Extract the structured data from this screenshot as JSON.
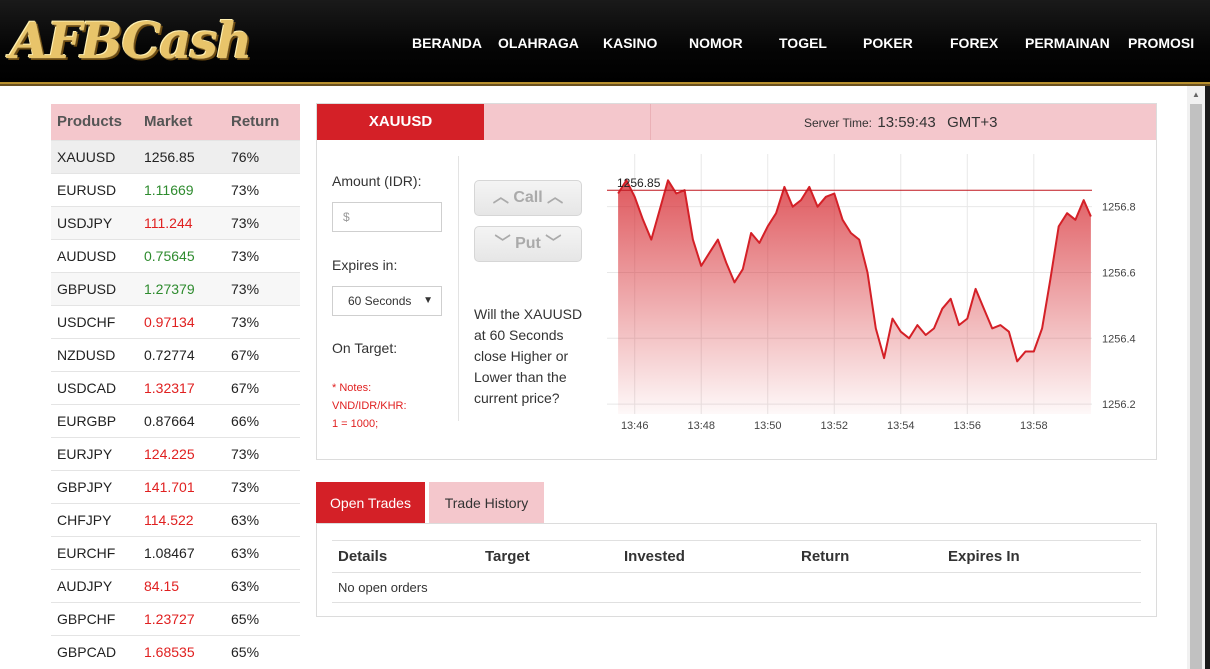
{
  "header": {
    "logo_text": "AFBCash",
    "nav": [
      "BERANDA",
      "OLAHRAGA",
      "KASINO",
      "NOMOR",
      "TOGEL",
      "POKER",
      "FOREX",
      "PERMAINAN",
      "PROMOSI"
    ]
  },
  "products": {
    "headers": [
      "Products",
      "Market",
      "Return"
    ],
    "rows": [
      {
        "product": "XAUUSD",
        "market": "1256.85",
        "return": "76%",
        "trend": "neutral"
      },
      {
        "product": "EURUSD",
        "market": "1.11669",
        "return": "73%",
        "trend": "up"
      },
      {
        "product": "USDJPY",
        "market": "111.244",
        "return": "73%",
        "trend": "down"
      },
      {
        "product": "AUDUSD",
        "market": "0.75645",
        "return": "73%",
        "trend": "up"
      },
      {
        "product": "GBPUSD",
        "market": "1.27379",
        "return": "73%",
        "trend": "up"
      },
      {
        "product": "USDCHF",
        "market": "0.97134",
        "return": "73%",
        "trend": "down"
      },
      {
        "product": "NZDUSD",
        "market": "0.72774",
        "return": "67%",
        "trend": "neutral"
      },
      {
        "product": "USDCAD",
        "market": "1.32317",
        "return": "67%",
        "trend": "down"
      },
      {
        "product": "EURGBP",
        "market": "0.87664",
        "return": "66%",
        "trend": "neutral"
      },
      {
        "product": "EURJPY",
        "market": "124.225",
        "return": "73%",
        "trend": "down"
      },
      {
        "product": "GBPJPY",
        "market": "141.701",
        "return": "73%",
        "trend": "down"
      },
      {
        "product": "CHFJPY",
        "market": "114.522",
        "return": "63%",
        "trend": "down"
      },
      {
        "product": "EURCHF",
        "market": "1.08467",
        "return": "63%",
        "trend": "neutral"
      },
      {
        "product": "AUDJPY",
        "market": "84.15",
        "return": "63%",
        "trend": "down"
      },
      {
        "product": "GBPCHF",
        "market": "1.23727",
        "return": "65%",
        "trend": "down"
      },
      {
        "product": "GBPCAD",
        "market": "1.68535",
        "return": "65%",
        "trend": "down"
      }
    ]
  },
  "trade": {
    "symbol": "XAUUSD",
    "server_time_label": "Server Time:",
    "server_time": "13:59:43",
    "timezone": "GMT+3",
    "amount_label": "Amount (IDR):",
    "amount_placeholder": "$",
    "expires_label": "Expires in:",
    "expires_value": "60 Seconds",
    "on_target_label": "On Target:",
    "notes": [
      "* Notes:",
      "VND/IDR/KHR:",
      "1 = 1000;"
    ],
    "call_label": "Call",
    "put_label": "Put",
    "question": "Will the XAUUSD at 60 Seconds close Higher or Lower than the current price?"
  },
  "chart_data": {
    "type": "area",
    "x": [
      "13:45:30",
      "13:45:45",
      "13:46:00",
      "13:46:15",
      "13:46:30",
      "13:46:45",
      "13:47:00",
      "13:47:15",
      "13:47:30",
      "13:47:45",
      "13:48:00",
      "13:48:15",
      "13:48:30",
      "13:48:45",
      "13:49:00",
      "13:49:15",
      "13:49:30",
      "13:49:45",
      "13:50:00",
      "13:50:15",
      "13:50:30",
      "13:50:45",
      "13:51:00",
      "13:51:15",
      "13:51:30",
      "13:51:45",
      "13:52:00",
      "13:52:15",
      "13:52:30",
      "13:52:45",
      "13:53:00",
      "13:53:15",
      "13:53:30",
      "13:53:45",
      "13:54:00",
      "13:54:15",
      "13:54:30",
      "13:54:45",
      "13:55:00",
      "13:55:15",
      "13:55:30",
      "13:55:45",
      "13:56:00",
      "13:56:15",
      "13:56:30",
      "13:56:45",
      "13:57:00",
      "13:57:15",
      "13:57:30",
      "13:57:45",
      "13:58:00",
      "13:58:15",
      "13:58:30",
      "13:58:45",
      "13:59:00",
      "13:59:15",
      "13:59:30",
      "13:59:43"
    ],
    "values": [
      1256.84,
      1256.88,
      1256.83,
      1256.76,
      1256.7,
      1256.79,
      1256.88,
      1256.84,
      1256.85,
      1256.7,
      1256.62,
      1256.66,
      1256.7,
      1256.63,
      1256.57,
      1256.61,
      1256.72,
      1256.69,
      1256.74,
      1256.78,
      1256.86,
      1256.8,
      1256.82,
      1256.86,
      1256.8,
      1256.83,
      1256.84,
      1256.76,
      1256.72,
      1256.7,
      1256.6,
      1256.43,
      1256.34,
      1256.46,
      1256.42,
      1256.4,
      1256.44,
      1256.41,
      1256.43,
      1256.49,
      1256.52,
      1256.44,
      1256.46,
      1256.55,
      1256.49,
      1256.43,
      1256.44,
      1256.42,
      1256.33,
      1256.36,
      1256.36,
      1256.43,
      1256.58,
      1256.74,
      1256.78,
      1256.76,
      1256.82,
      1256.77
    ],
    "current_value": "1256.85",
    "current_line": 1256.85,
    "x_ticks": [
      "13:46",
      "13:48",
      "13:50",
      "13:52",
      "13:54",
      "13:56",
      "13:58"
    ],
    "y_ticks": [
      "1256.8",
      "1256.6",
      "1256.4",
      "1256.2"
    ],
    "ylim": [
      1256.17,
      1256.96
    ],
    "color": "#d42027",
    "grid": true
  },
  "trades": {
    "tabs": [
      "Open Trades",
      "Trade History"
    ],
    "columns": [
      "Details",
      "Target",
      "Invested",
      "Return",
      "Expires In"
    ],
    "empty_message": "No open orders"
  },
  "colors": {
    "accent": "#d42027",
    "light_accent": "#f4c7cc",
    "up": "#2e8b2e",
    "down": "#e02020"
  }
}
